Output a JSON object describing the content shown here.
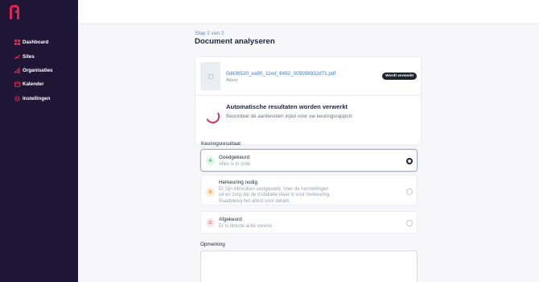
{
  "sidebar": {
    "items": [
      {
        "label": "Dashboard",
        "icon": "grid-icon"
      },
      {
        "label": "Sites",
        "icon": "chart-icon"
      },
      {
        "label": "Organisaties",
        "icon": "org-chart-icon"
      },
      {
        "label": "Kalender",
        "icon": "calendar-icon"
      },
      {
        "label": "Instellingen",
        "icon": "gear-icon"
      }
    ]
  },
  "header": {
    "step": "Stap 2 van 2",
    "title": "Document analyseren"
  },
  "document": {
    "file_name": "0d438520_ea90_11ed_8492_005056932d71.pdf",
    "file_type": "Attest",
    "status_badge": "Wordt verwerkt"
  },
  "processing": {
    "title": "Automatische resultaten worden verwerkt",
    "subtitle": "Beoordeel de aanbevolen input voor uw keuringsrapport"
  },
  "result": {
    "label": "Keuringsresultaat",
    "options": [
      {
        "letter": "A",
        "title": "Goedgekeurd",
        "lines": [
          "Alles is in orde"
        ],
        "selected": true
      },
      {
        "letter": "B",
        "title": "Herkeuring nodig",
        "lines": [
          "Er zijn inbreuken vastgesteld. Voer de herstellingen",
          "uit en zorg dat de installatie klaar is voor herkeuring.",
          "Raadpleeg het attest voor details."
        ],
        "selected": false
      },
      {
        "letter": "C",
        "title": "Afgekeurd",
        "lines": [
          "Er is directe actie vereist."
        ],
        "selected": false
      }
    ]
  },
  "remark": {
    "label": "Opmerking",
    "value": ""
  },
  "colors": {
    "sidebar_bg": "#1f1534",
    "accent": "#e0244f",
    "link": "#3b79d8",
    "option_a_bg": "#e3f5ea",
    "option_a_fg": "#2e9a58",
    "option_b_bg": "#fdebd8",
    "option_b_fg": "#d9802a",
    "option_c_bg": "#fde6e6",
    "option_c_fg": "#d94646"
  }
}
